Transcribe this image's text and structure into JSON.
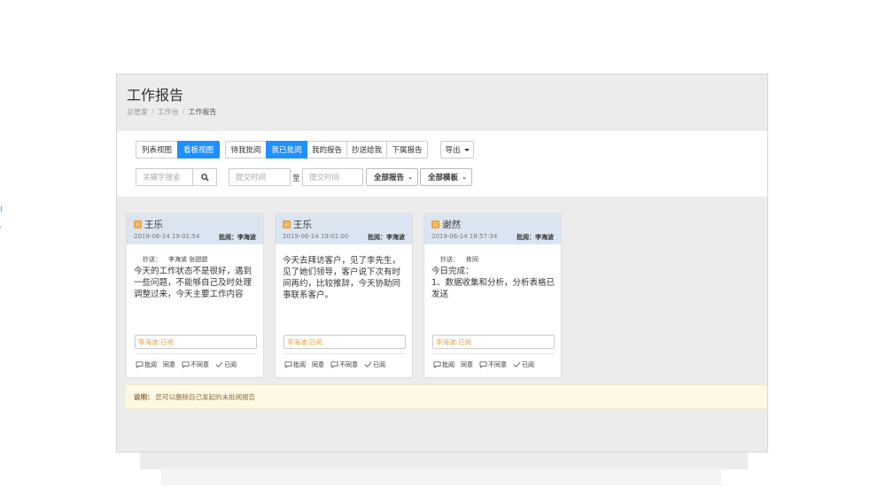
{
  "page": {
    "title": "工作报告",
    "breadcrumb": [
      "总管家",
      "工作台",
      "工作报告"
    ]
  },
  "toolbar": {
    "view_tabs": [
      "列表视图",
      "看板视图"
    ],
    "filter_tabs": [
      "待我批阅",
      "我已批阅",
      "我的报告",
      "抄送给我",
      "下属报告"
    ],
    "export_label": "导出",
    "search_placeholder": "关键字搜索",
    "date_from_placeholder": "提交时间",
    "date_to_label": "至",
    "date_to_placeholder": "提交时间",
    "report_filter": "全部报告",
    "template_filter": "全部模板"
  },
  "cards": [
    {
      "author": "王乐",
      "time": "2019-06-14 19:01:54",
      "approver": "批阅：李海波",
      "cc_label": "抄送：",
      "cc_names": "李海波 张甜甜",
      "content": "今天的工作状态不是很好，遇到一些问题，不能够自己及时处理调整过来，今天主要工作内容",
      "status": "李海波:已阅",
      "actions": [
        "批阅",
        "同意",
        "不同意",
        "已阅"
      ]
    },
    {
      "author": "王乐",
      "time": "2019-06-14 19:01:00",
      "approver": "批阅：李海波",
      "cc_label": "",
      "cc_names": "",
      "content": "今天去拜访客户，见了李先生，见了她们领导，客户说下次有时间再约，比较推辞，今天协助同事联系客户。",
      "status": "李海波:已阅",
      "actions": [
        "批阅",
        "同意",
        "不同意",
        "已阅"
      ]
    },
    {
      "author": "谢然",
      "time": "2019-06-14 18:57:34",
      "approver": "批阅：李海波",
      "cc_label": "抄送：",
      "cc_names": "栋同",
      "content": "今日完成：\n1、数据收集和分析，分析表格已发送",
      "status": "李海波:已阅",
      "actions": [
        "批阅",
        "同意",
        "不同意",
        "已阅"
      ]
    }
  ],
  "notice": {
    "label": "说明：",
    "text": "您可以删除自己发起的未批阅报告"
  },
  "colors": {
    "accent": "#1e90ff",
    "card_header": "#dbe5f1",
    "status_text": "#f0a030",
    "notice_bg": "#fcf8e3"
  }
}
